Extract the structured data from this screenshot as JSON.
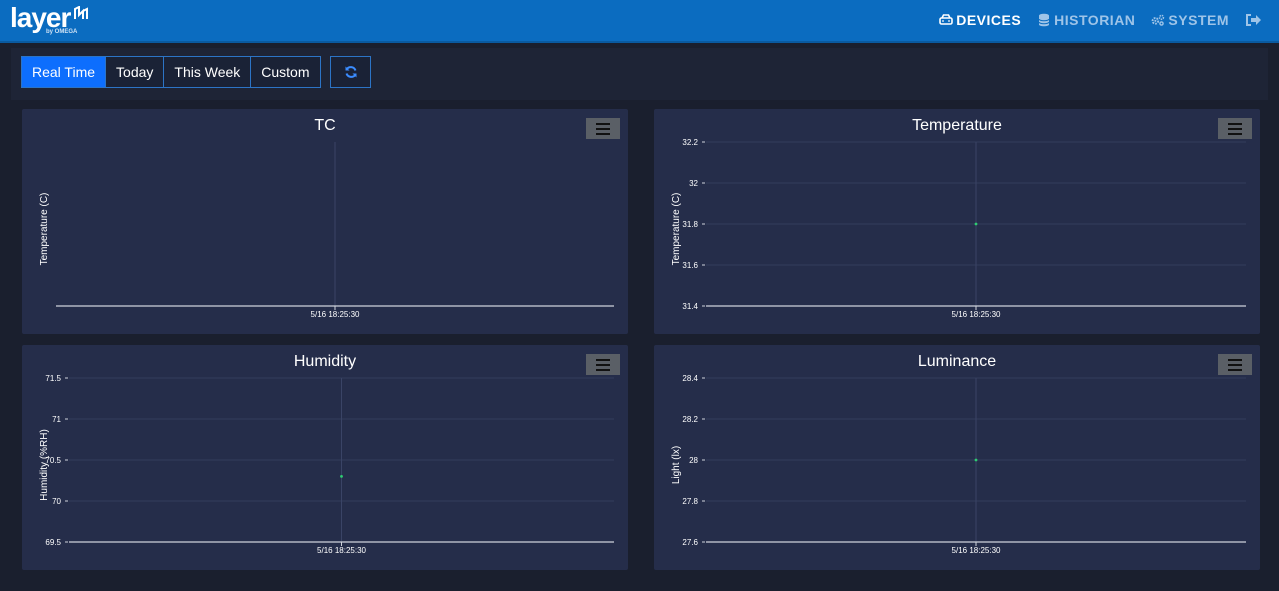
{
  "header": {
    "logo_text": "layer",
    "logo_by": "by OMEGA",
    "nav": [
      {
        "label": "DEVICES",
        "icon": "devices-icon",
        "active": true
      },
      {
        "label": "HISTORIAN",
        "icon": "database-icon",
        "active": false
      },
      {
        "label": "SYSTEM",
        "icon": "gears-icon",
        "active": false
      },
      {
        "label": "",
        "icon": "sign-out-icon",
        "active": false
      }
    ]
  },
  "toolbar": {
    "ranges": [
      "Real Time",
      "Today",
      "This Week",
      "Custom"
    ],
    "active_range": "Real Time",
    "refresh_icon": "refresh-icon"
  },
  "colors": {
    "header_bg": "#0b6cc0",
    "panel_bg": "#252d4a",
    "active_button": "#0d6efd",
    "point_color": "#2ecc71"
  },
  "charts": [
    {
      "title": "TC",
      "ylabel": "Temperature (C)",
      "x_tick": "5/16 18:25:30",
      "yticks": [],
      "points": []
    },
    {
      "title": "Temperature",
      "ylabel": "Temperature (C)",
      "x_tick": "5/16 18:25:30",
      "yticks": [
        "31.4",
        "31.6",
        "31.8",
        "32",
        "32.2"
      ],
      "ylim": [
        31.4,
        32.2
      ],
      "points": [
        31.8
      ]
    },
    {
      "title": "Humidity",
      "ylabel": "Humidity (%RH)",
      "x_tick": "5/16 18:25:30",
      "yticks": [
        "69.5",
        "70",
        "70.5",
        "71",
        "71.5"
      ],
      "ylim": [
        69.5,
        71.5
      ],
      "points": [
        70.3
      ]
    },
    {
      "title": "Luminance",
      "ylabel": "Light (lx)",
      "x_tick": "5/16 18:25:30",
      "yticks": [
        "27.6",
        "27.8",
        "28",
        "28.2",
        "28.4"
      ],
      "ylim": [
        27.6,
        28.4
      ],
      "points": [
        28
      ]
    }
  ],
  "chart_data": [
    {
      "type": "scatter",
      "title": "TC",
      "ylabel": "Temperature (C)",
      "x": [
        "5/16 18:25:30"
      ],
      "series": []
    },
    {
      "type": "scatter",
      "title": "Temperature",
      "ylabel": "Temperature (C)",
      "x": [
        "5/16 18:25:30"
      ],
      "ylim": [
        31.4,
        32.2
      ],
      "series": [
        {
          "values": [
            31.8
          ]
        }
      ]
    },
    {
      "type": "scatter",
      "title": "Humidity",
      "ylabel": "Humidity (%RH)",
      "x": [
        "5/16 18:25:30"
      ],
      "ylim": [
        69.5,
        71.5
      ],
      "series": [
        {
          "values": [
            70.3
          ]
        }
      ]
    },
    {
      "type": "scatter",
      "title": "Luminance",
      "ylabel": "Light (lx)",
      "x": [
        "5/16 18:25:30"
      ],
      "ylim": [
        27.6,
        28.4
      ],
      "series": [
        {
          "values": [
            28
          ]
        }
      ]
    }
  ]
}
